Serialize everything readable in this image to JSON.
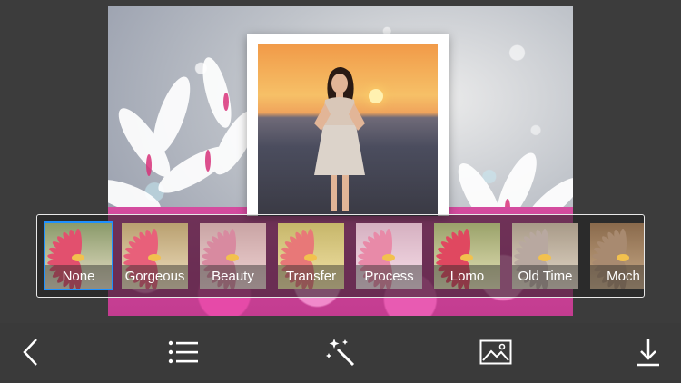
{
  "colors": {
    "background": "#3a3a3a",
    "selection_border": "#1e90ff",
    "strip_border": "#e8e8e8",
    "icon": "#ffffff"
  },
  "filters": [
    {
      "label": "None",
      "tint": "none",
      "selected": true
    },
    {
      "label": "Gorgeous",
      "tint": "warm"
    },
    {
      "label": "Beauty",
      "tint": "pink"
    },
    {
      "label": "Transfer",
      "tint": "yellow"
    },
    {
      "label": "Process",
      "tint": "pink-light"
    },
    {
      "label": "Lomo",
      "tint": "green"
    },
    {
      "label": "Old Time",
      "tint": "sepia"
    },
    {
      "label": "Moch",
      "tint": "brown"
    }
  ],
  "toolbar": {
    "back_icon": "chevron-left-icon",
    "list_icon": "list-icon",
    "magic_icon": "magic-wand-icon",
    "image_icon": "image-icon",
    "download_icon": "download-icon"
  }
}
